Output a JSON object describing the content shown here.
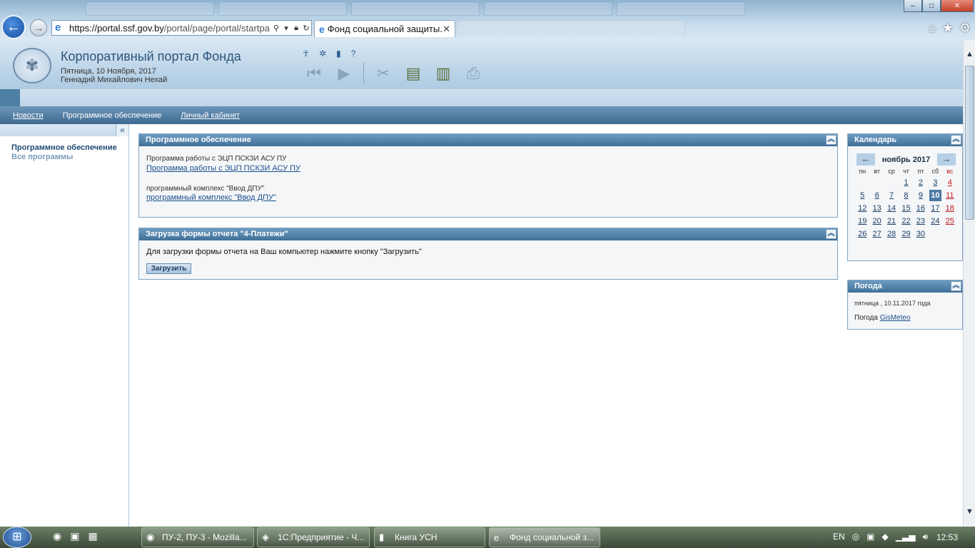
{
  "browser": {
    "address_domain": "https://portal.ssf.gov.by",
    "address_rest": "/portal/page/portal/startpa",
    "tab_title": "Фонд социальной защиты..."
  },
  "portal": {
    "title": "Корпоративный портал Фонда",
    "date": "Пятница, 10 Ноября, 2017",
    "user": "Геннадий Михайлович Нехай"
  },
  "nav": {
    "items": [
      {
        "label": "Новости"
      },
      {
        "label": "Программное обеспечение"
      },
      {
        "label": "Личный кабинет"
      }
    ]
  },
  "sidebar": {
    "item1": "Программное обеспечение",
    "item2": "Все программы"
  },
  "software": {
    "title": "Программное обеспечение",
    "entries": [
      {
        "caption": "Программа работы с ЭЦП ПСКЗИ АСУ ПУ",
        "link": "Программа работы с ЭЦП ПСКЗИ АСУ ПУ"
      },
      {
        "caption": "программный комплекс \"Ввод ДПУ\"",
        "link": "программный комплекс \"Ввод ДПУ\""
      }
    ]
  },
  "upload": {
    "title": "Загрузка формы отчета \"4-Платежи\"",
    "text": "Для загрузки формы отчета на Ваш компьютер нажмите кнопку \"Загрузить\"",
    "button": "Загрузить"
  },
  "calendar": {
    "title": "Календарь",
    "month": "ноябрь 2017",
    "prev": "←",
    "next": "→",
    "weekdays": [
      "пн",
      "вт",
      "ср",
      "чт",
      "пт",
      "сб",
      "вс"
    ],
    "today": 10,
    "days": [
      "",
      "",
      "",
      "1",
      "2",
      "3",
      "4",
      "5",
      "6",
      "7",
      "8",
      "9",
      "10",
      "11",
      "12",
      "13",
      "14",
      "15",
      "16",
      "17",
      "18",
      "19",
      "20",
      "21",
      "22",
      "23",
      "24",
      "25",
      "26",
      "27",
      "28",
      "29",
      "30"
    ]
  },
  "weather": {
    "title": "Погода",
    "date": "пятница , 10.11.2017 года",
    "label": "Погода",
    "link": "GisMeteo"
  },
  "taskbar": {
    "tasks": [
      {
        "label": "ПУ-2, ПУ-3 - Mozilla..."
      },
      {
        "label": "1С:Предприятие - Ч..."
      },
      {
        "label": "Книга УСН"
      },
      {
        "label": "Фонд социальной з..."
      }
    ],
    "lang": "EN",
    "time": "12:53"
  }
}
